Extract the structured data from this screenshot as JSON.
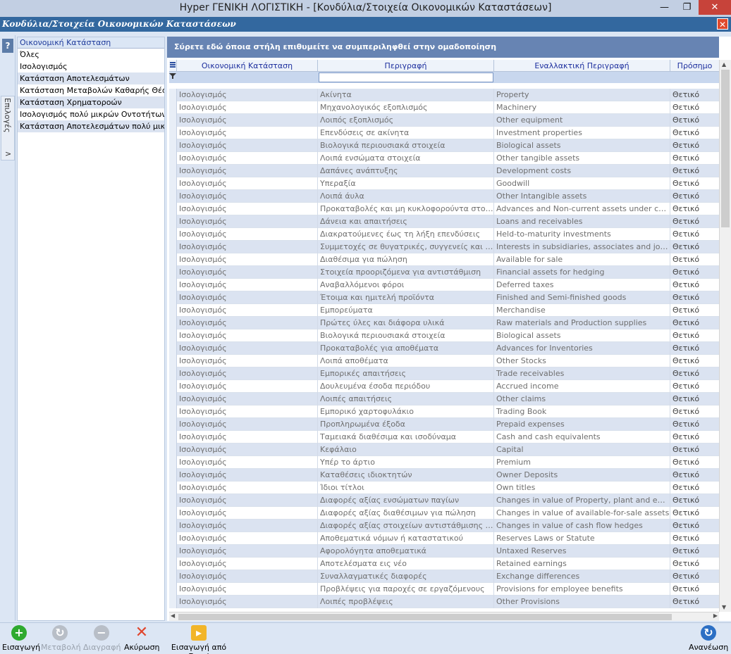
{
  "window": {
    "title": "Hyper ΓΕΝΙΚΗ ΛΟΓΙΣΤΙΚΗ - [Κονδύλια/Στοιχεία Οικονομικών Καταστάσεων]",
    "min_glyph": "—",
    "max_glyph": "❐",
    "close_glyph": "✕"
  },
  "child": {
    "title": "Κονδύλια/Στοιχεία Οικονομικών Καταστάσεων",
    "close_glyph": "✕"
  },
  "strip": {
    "help_glyph": "?",
    "tab_label": "Επιλογές",
    "tab_arrow": ">"
  },
  "categories": {
    "header": "Οικονομική Κατάσταση",
    "items": [
      "Όλες",
      "Ισολογισμός",
      "Κατάσταση Αποτελεσμάτων",
      "Κατάσταση Μεταβολών Καθαρής Θέσης",
      "Κατάσταση Χρηματοροών",
      "Ισολογισμός πολύ μικρών Οντοτήτων",
      "Κατάσταση Αποτελεσμάτων πολύ μικρών Οντοτήτων"
    ]
  },
  "grid": {
    "group_prompt": "Σύρετε εδώ όποια στήλη επιθυμείτε να συμπεριληφθεί στην ομαδοποίηση",
    "columns": [
      "Οικονομική Κατάσταση",
      "Περιγραφή",
      "Εναλλακτική Περιγραφή",
      "Πρόσημο"
    ],
    "rows": [
      [
        "Ισολογισμός",
        "Ακίνητα",
        "Property",
        "Θετικό"
      ],
      [
        "Ισολογισμός",
        "Μηχανολογικός εξοπλισμός",
        "Machinery",
        "Θετικό"
      ],
      [
        "Ισολογισμός",
        "Λοιπός εξοπλισμός",
        "Other equipment",
        "Θετικό"
      ],
      [
        "Ισολογισμός",
        "Επενδύσεις σε ακίνητα",
        "Investment properties",
        "Θετικό"
      ],
      [
        "Ισολογισμός",
        "Βιολογικά περιουσιακά στοιχεία",
        "Biological assets",
        "Θετικό"
      ],
      [
        "Ισολογισμός",
        "Λοιπά ενσώματα στοιχεία",
        "Other tangible assets",
        "Θετικό"
      ],
      [
        "Ισολογισμός",
        "Δαπάνες ανάπτυξης",
        "Development costs",
        "Θετικό"
      ],
      [
        "Ισολογισμός",
        "Υπεραξία",
        "Goodwill",
        "Θετικό"
      ],
      [
        "Ισολογισμός",
        "Λοιπά άυλα",
        "Other Intangible assets",
        "Θετικό"
      ],
      [
        "Ισολογισμός",
        "Προκαταβολές και μη κυκλοφορούντα στοιχεία υπό κατασκευή",
        "Advances and Non-current assets under construction",
        "Θετικό"
      ],
      [
        "Ισολογισμός",
        "Δάνεια και απαιτήσεις",
        "Loans and receivables",
        "Θετικό"
      ],
      [
        "Ισολογισμός",
        "Διακρατούμενες έως τη λήξη επενδύσεις",
        "Held-to-maturity investments",
        "Θετικό"
      ],
      [
        "Ισολογισμός",
        "Συμμετοχές σε θυγατρικές, συγγενείς και κοινοπραξίες",
        "Interests in subsidiaries, associates and joint ventures",
        "Θετικό"
      ],
      [
        "Ισολογισμός",
        "Διαθέσιμα για πώληση",
        "Available for sale",
        "Θετικό"
      ],
      [
        "Ισολογισμός",
        "Στοιχεία προοριζόμενα για αντιστάθμιση",
        "Financial assets for hedging",
        "Θετικό"
      ],
      [
        "Ισολογισμός",
        "Αναβαλλόμενοι φόροι",
        "Deferred taxes",
        "Θετικό"
      ],
      [
        "Ισολογισμός",
        "Έτοιμα και ημιτελή προϊόντα",
        "Finished and Semi-finished goods",
        "Θετικό"
      ],
      [
        "Ισολογισμός",
        "Εμπορεύματα",
        "Merchandise",
        "Θετικό"
      ],
      [
        "Ισολογισμός",
        "Πρώτες ύλες και διάφορα υλικά",
        "Raw materials and Production supplies",
        "Θετικό"
      ],
      [
        "Ισολογισμός",
        "Βιολογικά περιουσιακά στοιχεία",
        "Biological assets",
        "Θετικό"
      ],
      [
        "Ισολογισμός",
        "Προκαταβολές για αποθέματα",
        "Advances for Inventories",
        "Θετικό"
      ],
      [
        "Ισολογισμός",
        "Λοιπά αποθέματα",
        "Other Stocks",
        "Θετικό"
      ],
      [
        "Ισολογισμός",
        "Εμπορικές απαιτήσεις",
        "Trade receivables",
        "Θετικό"
      ],
      [
        "Ισολογισμός",
        "Δουλευμένα έσοδα περιόδου",
        "Accrued income",
        "Θετικό"
      ],
      [
        "Ισολογισμός",
        "Λοιπές απαιτήσεις",
        "Other claims",
        "Θετικό"
      ],
      [
        "Ισολογισμός",
        "Εμπορικό χαρτοφυλάκιο",
        "Trading Book",
        "Θετικό"
      ],
      [
        "Ισολογισμός",
        "Προπληρωμένα έξοδα",
        "Prepaid expenses",
        "Θετικό"
      ],
      [
        "Ισολογισμός",
        "Ταμειακά διαθέσιμα και ισοδύναμα",
        "Cash and cash equivalents",
        "Θετικό"
      ],
      [
        "Ισολογισμός",
        "Κεφάλαιο",
        "Capital",
        "Θετικό"
      ],
      [
        "Ισολογισμός",
        "Υπέρ το άρτιο",
        "Premium",
        "Θετικό"
      ],
      [
        "Ισολογισμός",
        "Καταθέσεις ιδιοκτητών",
        "Owner Deposits",
        "Θετικό"
      ],
      [
        "Ισολογισμός",
        "Ίδιοι τίτλοι",
        "Own titles",
        "Θετικό"
      ],
      [
        "Ισολογισμός",
        "Διαφορές αξίας ενσώματων παγίων",
        "Changes in value of Property, plant and equipment",
        "Θετικό"
      ],
      [
        "Ισολογισμός",
        "Διαφορές αξίας διαθέσιμων για πώληση",
        "Changes in value of available-for-sale assets",
        "Θετικό"
      ],
      [
        "Ισολογισμός",
        "Διαφορές αξίας στοιχείων αντιστάθμισης ταμειακών ροών",
        "Changes in value of cash flow hedges",
        "Θετικό"
      ],
      [
        "Ισολογισμός",
        "Αποθεματικά νόμων ή καταστατικού",
        "Reserves Laws or Statute",
        "Θετικό"
      ],
      [
        "Ισολογισμός",
        "Αφορολόγητα αποθεματικά",
        "Untaxed Reserves",
        "Θετικό"
      ],
      [
        "Ισολογισμός",
        "Αποτελέσματα εις νέο",
        "Retained earnings",
        "Θετικό"
      ],
      [
        "Ισολογισμός",
        "Συναλλαγματικές διαφορές",
        "Exchange differences",
        "Θετικό"
      ],
      [
        "Ισολογισμός",
        "Προβλέψεις για παροχές σε εργαζόμενους",
        "Provisions for employee benefits",
        "Θετικό"
      ],
      [
        "Ισολογισμός",
        "Λοιπές προβλέψεις",
        "Other Provisions",
        "Θετικό"
      ]
    ]
  },
  "toolbar": {
    "insert": "Εισαγωγή",
    "modify": "Μεταβολή",
    "delete": "Διαγραφή",
    "cancel": "Ακύρωση",
    "import_excel": "Εισαγωγή από Excel",
    "refresh": "Ανανέωση"
  },
  "colors": {
    "group_bar": "#6784b3",
    "child_header": "#33689f",
    "insert_icon": "#2faa2f",
    "cancel_icon": "#e0462d",
    "refresh_icon": "#2c6fc4"
  }
}
